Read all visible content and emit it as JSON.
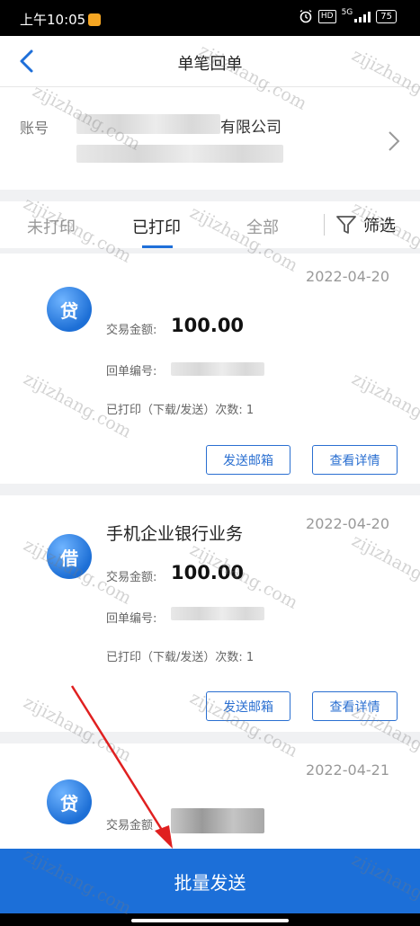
{
  "status": {
    "time": "上午10:05",
    "network": "5G",
    "hd": "HD",
    "battery": "75"
  },
  "nav": {
    "title": "单笔回单"
  },
  "account": {
    "label": "账号",
    "name_suffix": "有限公司"
  },
  "tabs": [
    {
      "label": "未打印"
    },
    {
      "label": "已打印",
      "active": true
    },
    {
      "label": "全部"
    }
  ],
  "filter": {
    "label": "筛选"
  },
  "records": [
    {
      "date": "2022-04-20",
      "type": "贷",
      "amount_label": "交易金额:",
      "amount": "100.00",
      "receipt_label": "回单编号:",
      "print_count_label": "已打印（下载/发送）次数:",
      "print_count": "1",
      "send_label": "发送邮箱",
      "detail_label": "查看详情"
    },
    {
      "date": "2022-04-20",
      "type": "借",
      "business_name": "手机企业银行业务",
      "amount_label": "交易金额:",
      "amount": "100.00",
      "receipt_label": "回单编号:",
      "print_count_label": "已打印（下载/发送）次数:",
      "print_count": "1",
      "send_label": "发送邮箱",
      "detail_label": "查看详情"
    },
    {
      "date": "2022-04-21",
      "type": "贷",
      "amount_label": "交易金额"
    }
  ],
  "bottom": {
    "batch_send_label": "批量发送"
  },
  "watermark": "zijizhang.com",
  "colors": {
    "primary": "#1c6fd8",
    "badge": "#2a7be0",
    "arrow": "#e02020"
  }
}
